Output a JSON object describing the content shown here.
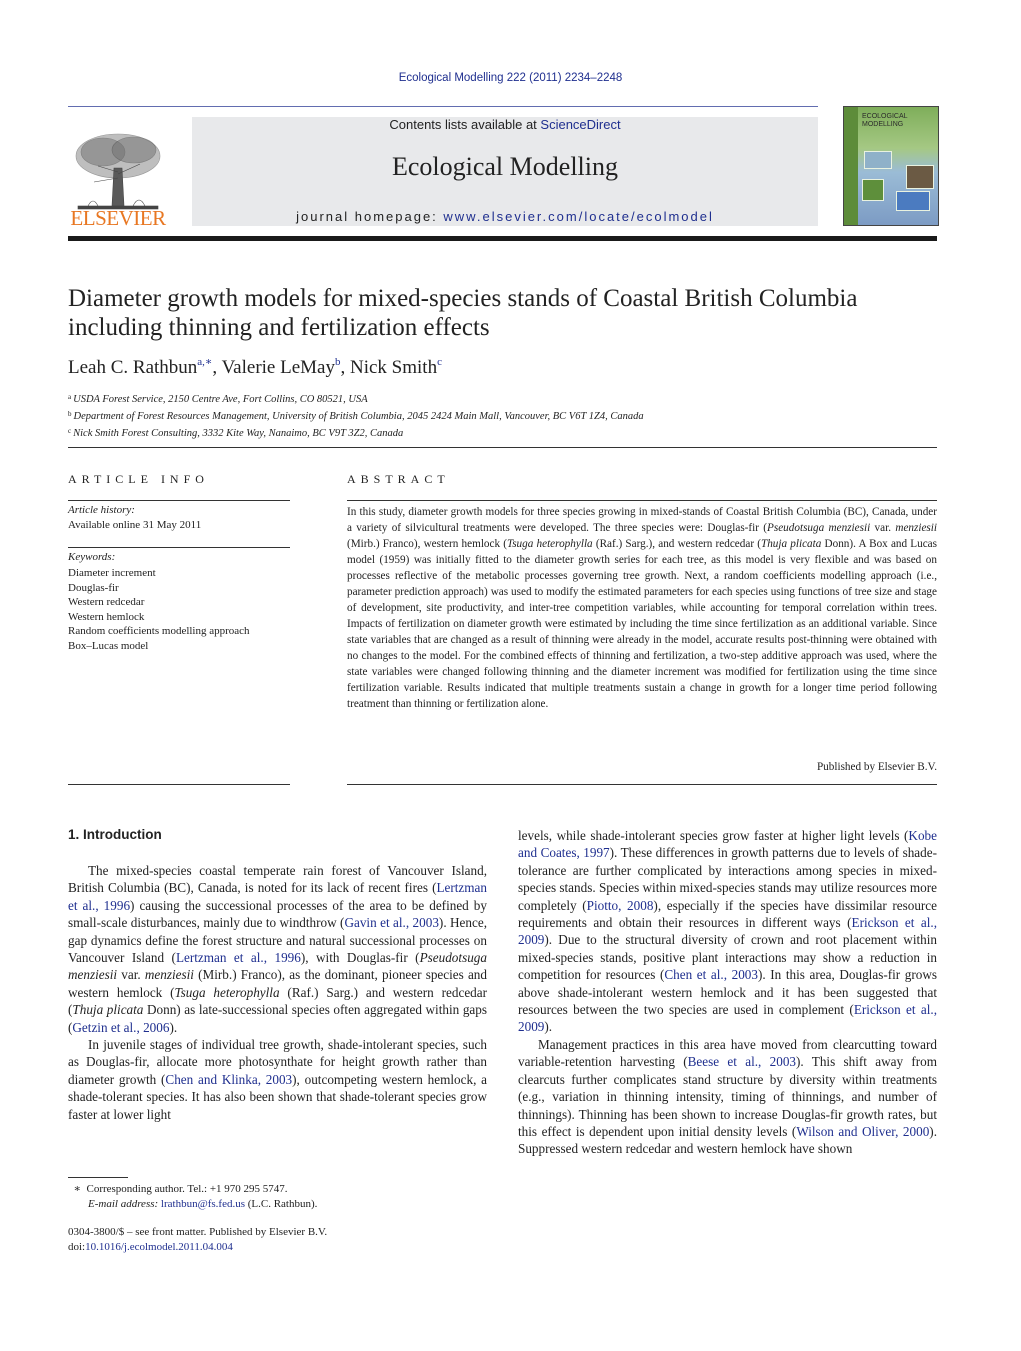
{
  "header": {
    "journal_ref": "Ecological Modelling 222 (2011) 2234–2248",
    "publisher_logo_text": "ELSEVIER",
    "publisher_logo_icon": "elsevier-tree-icon",
    "contents_prefix": "Contents lists available at ",
    "contents_link": "ScienceDirect",
    "journal_title": "Ecological Modelling",
    "homepage_prefix": "journal homepage: ",
    "homepage_link": "www.elsevier.com/locate/ecolmodel",
    "cover": {
      "title_line1": "ECOLOGICAL",
      "title_line2": "MODELLING",
      "icon": "journal-cover-image"
    }
  },
  "article": {
    "title": "Diameter growth models for mixed-species stands of Coastal British Columbia including thinning and fertilization effects",
    "authors": [
      {
        "name": "Leah C. Rathbun",
        "sup": "a,∗"
      },
      {
        "name": "Valerie LeMay",
        "sup": "b"
      },
      {
        "name": "Nick Smith",
        "sup": "c"
      }
    ],
    "affiliations": [
      {
        "sup": "a",
        "text": "USDA Forest Service, 2150 Centre Ave, Fort Collins, CO 80521, USA"
      },
      {
        "sup": "b",
        "text": "Department of Forest Resources Management, University of British Columbia, 2045 2424 Main Mall, Vancouver, BC V6T 1Z4, Canada"
      },
      {
        "sup": "c",
        "text": "Nick Smith Forest Consulting, 3332 Kite Way, Nanaimo, BC V9T 3Z2, Canada"
      }
    ]
  },
  "article_info": {
    "heading": "ARTICLE INFO",
    "history_label": "Article history:",
    "history_value": "Available online 31 May 2011",
    "keywords_label": "Keywords:",
    "keywords": [
      "Diameter increment",
      "Douglas-fir",
      "Western redcedar",
      "Western hemlock",
      "Random coefficients modelling approach",
      "Box–Lucas model"
    ]
  },
  "abstract": {
    "heading": "ABSTRACT",
    "parts": [
      "In this study, diameter growth models for three species growing in mixed-stands of Coastal British Columbia (BC), Canada, under a variety of silvicultural treatments were developed. The three species were: Douglas-fir (",
      "Pseudotsuga menziesii",
      " var. ",
      "menziesii",
      " (Mirb.) Franco), western hemlock (",
      "Tsuga heterophylla",
      " (Raf.) Sarg.), and western redcedar (",
      "Thuja plicata",
      " Donn). A Box and Lucas model (1959) was initially fitted to the diameter growth series for each tree, as this model is very flexible and was based on processes reflective of the metabolic processes governing tree growth. Next, a random coefficients modelling approach (i.e., parameter prediction approach) was used to modify the estimated parameters for each species using functions of tree size and stage of development, site productivity, and inter-tree competition variables, while accounting for temporal correlation within trees. Impacts of fertilization on diameter growth were estimated by including the time since fertilization as an additional variable. Since state variables that are changed as a result of thinning were already in the model, accurate results post-thinning were obtained with no changes to the model. For the combined effects of thinning and fertilization, a two-step additive approach was used, where the state variables were changed following thinning and the diameter increment was modified for fertilization using the time since fertilization variable. Results indicated that multiple treatments sustain a change in growth for a longer time period following treatment than thinning or fertilization alone."
    ],
    "published_by": "Published by Elsevier B.V."
  },
  "introduction": {
    "heading": "1.  Introduction",
    "left_p1": [
      "The mixed-species coastal temperate rain forest of Vancouver Island, British Columbia (BC), Canada, is noted for its lack of recent fires (",
      "Lertzman et al., 1996",
      ") causing the successional processes of the area to be defined by small-scale disturbances, mainly due to windthrow (",
      "Gavin et al., 2003",
      "). Hence, gap dynamics define the forest structure and natural successional processes on Vancouver Island (",
      "Lertzman et al., 1996",
      "), with Douglas-fir (",
      "Pseudotsuga menziesii",
      " var. ",
      "menziesii",
      " (Mirb.) Franco), as the dominant, pioneer species and western hemlock (",
      "Tsuga heterophylla",
      " (Raf.) Sarg.) and western redcedar (",
      "Thuja plicata",
      " Donn) as late-successional species often aggregated within gaps (",
      "Getzin et al., 2006",
      ")."
    ],
    "left_p2": [
      "In juvenile stages of individual tree growth, shade-intolerant species, such as Douglas-fir, allocate more photosynthate for height growth rather than diameter growth (",
      "Chen and Klinka, 2003",
      "), outcompeting western hemlock, a shade-tolerant species. It has also been shown that shade-tolerant species grow faster at lower light"
    ],
    "right_p1": [
      "levels, while shade-intolerant species grow faster at higher light levels (",
      "Kobe and Coates, 1997",
      "). These differences in growth patterns due to levels of shade-tolerance are further complicated by interactions among species in mixed-species stands. Species within mixed-species stands may utilize resources more completely (",
      "Piotto, 2008",
      "), especially if the species have dissimilar resource requirements and obtain their resources in different ways (",
      "Erickson et al., 2009",
      "). Due to the structural diversity of crown and root placement within mixed-species stands, positive plant interactions may show a reduction in competition for resources (",
      "Chen et al., 2003",
      "). In this area, Douglas-fir grows above shade-intolerant western hemlock and it has been suggested that resources between the two species are used in complement (",
      "Erickson et al., 2009",
      ")."
    ],
    "right_p2": [
      "Management practices in this area have moved from clearcutting toward variable-retention harvesting (",
      "Beese et al., 2003",
      "). This shift away from clearcuts further complicates stand structure by diversity within treatments (e.g., variation in thinning intensity, timing of thinnings, and number of thinnings). Thinning has been shown to increase Douglas-fir growth rates, but this effect is dependent upon initial density levels (",
      "Wilson and Oliver, 2000",
      "). Suppressed western redcedar and western hemlock have shown"
    ]
  },
  "footnote": {
    "marker": "∗",
    "corresponding": "Corresponding author. Tel.: +1 970 295 5747.",
    "email_label": "E-mail address:",
    "email": "lrathbun@fs.fed.us",
    "email_suffix": " (L.C. Rathbun)."
  },
  "bottom": {
    "issn_line": "0304-3800/$ – see front matter. Published by Elsevier B.V.",
    "doi_label": "doi:",
    "doi": "10.1016/j.ecolmodel.2011.04.004"
  }
}
